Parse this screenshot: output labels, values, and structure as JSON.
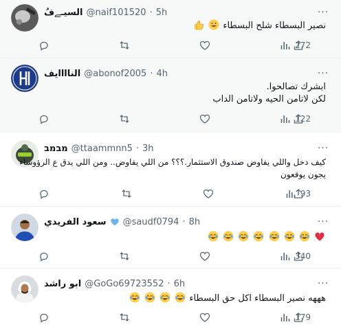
{
  "tweets": [
    {
      "display_name": "السيـﮯفُ",
      "handle": "@naif101520",
      "time": "5h",
      "text_lines": [
        "نصير البسطاء شلح البسطاء"
      ],
      "emoji_trail": [
        "grinning-face-emoji",
        "thumbs-up-emoji"
      ],
      "views": "272",
      "highlighted": true,
      "avatar": "dark-photo-avatar"
    },
    {
      "display_name": "الناااايف",
      "handle": "@abonof2005",
      "time": "4h",
      "text_lines": [
        "ابشرك تصالحوا.",
        "لكن لاتامن الحيه ولاتامن الداب"
      ],
      "views": "122",
      "highlighted": true,
      "avatar": "alhilal-logo-avatar"
    },
    {
      "display_name": "מבמב",
      "handle": "@ttaammnn5",
      "time": "3h",
      "text_lines": [
        "كيف دخل واللي يفاوض صندوق الاستثمار.؟؟؟ من اللي يفاوض.. ومن اللي يدق ع الرؤوساء",
        "يجون يوقعون"
      ],
      "views": "93",
      "highlighted": false,
      "avatar": "robot-avatar"
    },
    {
      "display_name": "سعود الفريدي",
      "handle": "@saudf0794",
      "time": "8h",
      "text_lines": [
        ""
      ],
      "emoji_line": [
        "broken-heart-emoji",
        "tears-of-joy-emoji",
        "tears-of-joy-emoji",
        "tears-of-joy-emoji",
        "tears-of-joy-emoji",
        "tears-of-joy-emoji",
        "tears-of-joy-emoji",
        "tears-of-joy-emoji"
      ],
      "views": "340",
      "highlighted": false,
      "avatar": "blue-jersey-avatar",
      "badge": "blue-heart-icon"
    },
    {
      "display_name": "ابو راشد",
      "handle": "@GoGo69723552",
      "time": "6h",
      "text_lines": [
        "هههه نصير البسطاء اكل حق البسطاء"
      ],
      "emoji_trail": [
        "tears-of-joy-emoji",
        "tears-of-joy-emoji",
        "tears-of-joy-emoji",
        "tears-of-joy-emoji"
      ],
      "views": "179",
      "highlighted": false,
      "avatar": "white-headdress-avatar"
    }
  ],
  "ui": {
    "dot": "·",
    "more_glyph": "···"
  },
  "colors": {
    "text": "#0f1419",
    "muted": "#536471",
    "divider": "#eff3f4",
    "highlight_bg": "#f7f9f9",
    "verified_blue": "#6cb4ee",
    "broken_heart": "#e0245e",
    "emoji_yellow": "#ffcc4d"
  }
}
